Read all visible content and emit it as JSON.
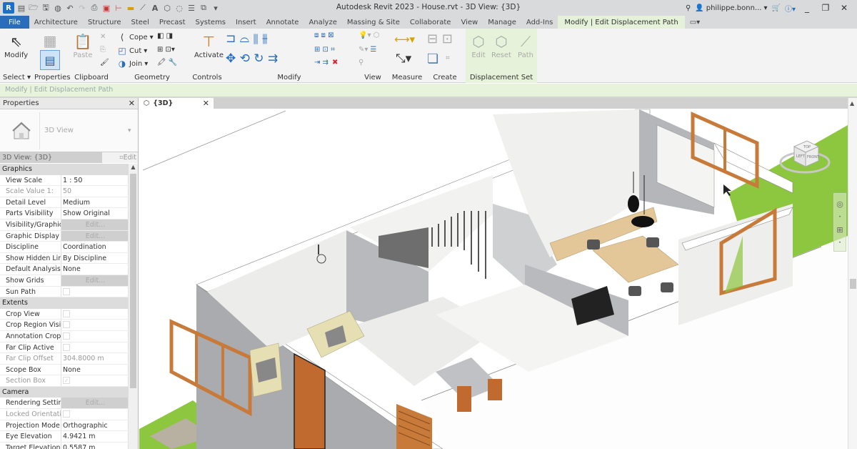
{
  "app": {
    "title": "Autodesk Revit 2023 - House.rvt - 3D View: {3D}",
    "logo": "R",
    "user": "philippe.bonn...",
    "window_controls": [
      "minimize",
      "restore",
      "close"
    ]
  },
  "quick_access": [
    "file-icon",
    "open-icon",
    "save-icon",
    "sync-icon",
    "undo-icon",
    "redo-icon",
    "print-icon",
    "pdf-icon",
    "measure-icon",
    "dimension-icon",
    "tag-icon",
    "text-icon",
    "3d-view-icon",
    "section-icon",
    "thin-lines-icon",
    "switch-windows-icon",
    "customize-icon"
  ],
  "tabs": [
    {
      "label": "File"
    },
    {
      "label": "Architecture"
    },
    {
      "label": "Structure"
    },
    {
      "label": "Steel"
    },
    {
      "label": "Precast"
    },
    {
      "label": "Systems"
    },
    {
      "label": "Insert"
    },
    {
      "label": "Annotate"
    },
    {
      "label": "Analyze"
    },
    {
      "label": "Massing & Site"
    },
    {
      "label": "Collaborate"
    },
    {
      "label": "View"
    },
    {
      "label": "Manage"
    },
    {
      "label": "Add-Ins"
    },
    {
      "label": "Modify | Edit Displacement Path"
    }
  ],
  "ribbon": {
    "select": {
      "modify": "Modify",
      "label": "Select ▾"
    },
    "properties": {
      "label": "Properties"
    },
    "clipboard": {
      "paste": "Paste",
      "label": "Clipboard"
    },
    "geometry": {
      "cope": "Cope",
      "cut": "Cut",
      "join": "Join",
      "label": "Geometry"
    },
    "controls": {
      "activate": "Activate",
      "label": "Controls"
    },
    "modify": {
      "label": "Modify"
    },
    "view": {
      "label": "View"
    },
    "measure": {
      "label": "Measure"
    },
    "create": {
      "label": "Create"
    },
    "displacement": {
      "edit": "Edit",
      "reset": "Reset",
      "path": "Path",
      "label": "Displacement Set"
    }
  },
  "context_bar": "Modify | Edit Displacement Path",
  "properties": {
    "title": "Properties",
    "type_name": "3D View",
    "selector": "3D View: {3D}",
    "edit_type": "Edit Type",
    "groups": [
      {
        "name": "Graphics",
        "rows": [
          {
            "key": "View Scale",
            "value": "1 : 50"
          },
          {
            "key": "Scale Value    1:",
            "value": "50",
            "dim": true
          },
          {
            "key": "Detail Level",
            "value": "Medium"
          },
          {
            "key": "Parts Visibility",
            "value": "Show Original"
          },
          {
            "key": "Visibility/Graphic...",
            "value": "Edit...",
            "button": true
          },
          {
            "key": "Graphic Display ...",
            "value": "Edit...",
            "button": true
          },
          {
            "key": "Discipline",
            "value": "Coordination"
          },
          {
            "key": "Show Hidden Lin...",
            "value": "By Discipline"
          },
          {
            "key": "Default Analysis ...",
            "value": "None"
          },
          {
            "key": "Show Grids",
            "value": "Edit...",
            "button": true
          },
          {
            "key": "Sun Path",
            "checkbox": false
          }
        ]
      },
      {
        "name": "Extents",
        "rows": [
          {
            "key": "Crop View",
            "checkbox": false
          },
          {
            "key": "Crop Region Visi...",
            "checkbox": false
          },
          {
            "key": "Annotation Crop",
            "checkbox": false
          },
          {
            "key": "Far Clip Active",
            "checkbox": false
          },
          {
            "key": "Far Clip Offset",
            "value": "304.8000 m",
            "dim": true
          },
          {
            "key": "Scope Box",
            "value": "None"
          },
          {
            "key": "Section Box",
            "checkbox": true,
            "dim": true
          }
        ]
      },
      {
        "name": "Camera",
        "rows": [
          {
            "key": "Rendering Settings",
            "value": "Edit...",
            "button": true
          },
          {
            "key": "Locked Orientati...",
            "checkbox": false,
            "dim": true
          },
          {
            "key": "Projection Mode",
            "value": "Orthographic"
          },
          {
            "key": "Eye Elevation",
            "value": "4.9421 m"
          },
          {
            "key": "Target Elevation",
            "value": "0.5587 m"
          }
        ]
      }
    ]
  },
  "view": {
    "tab_label": "{3D}",
    "viewcube": {
      "top": "TOP",
      "left": "LEFT",
      "front": "FRONT"
    }
  },
  "colors": {
    "file_tab": "#2a6ebb",
    "context_tab": "#e5f2d9",
    "grass": "#8dc63f",
    "wall_grey": "#a9abae",
    "wood": "#c87a3a",
    "floor_wood": "#e3c798"
  }
}
